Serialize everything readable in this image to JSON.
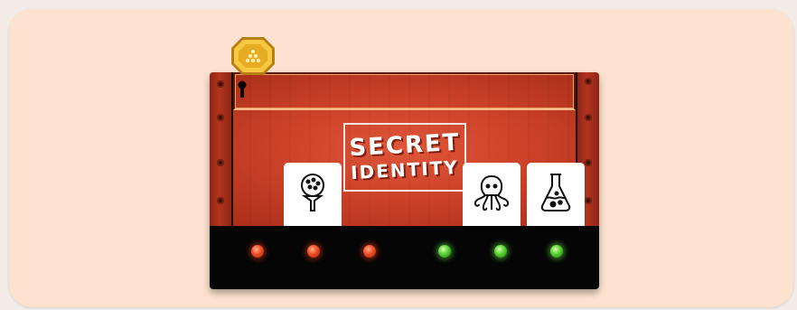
{
  "game": {
    "title_line1": "SECRET",
    "title_line2": "IDENTITY"
  },
  "coin": {
    "icon": "gold-coin-icon"
  },
  "chest": {
    "keyhole_icon": "keyhole-icon",
    "colors": {
      "lid": "#c73e26",
      "panel": "#fde3cf",
      "base": "#050505"
    }
  },
  "cards": [
    {
      "icon": "golf-ball-on-tee-icon"
    },
    {
      "icon": "octopus-icon"
    },
    {
      "icon": "flask-icon"
    }
  ],
  "lights": [
    {
      "status": "red"
    },
    {
      "status": "red"
    },
    {
      "status": "red"
    },
    {
      "status": "green"
    },
    {
      "status": "green"
    },
    {
      "status": "green"
    }
  ]
}
